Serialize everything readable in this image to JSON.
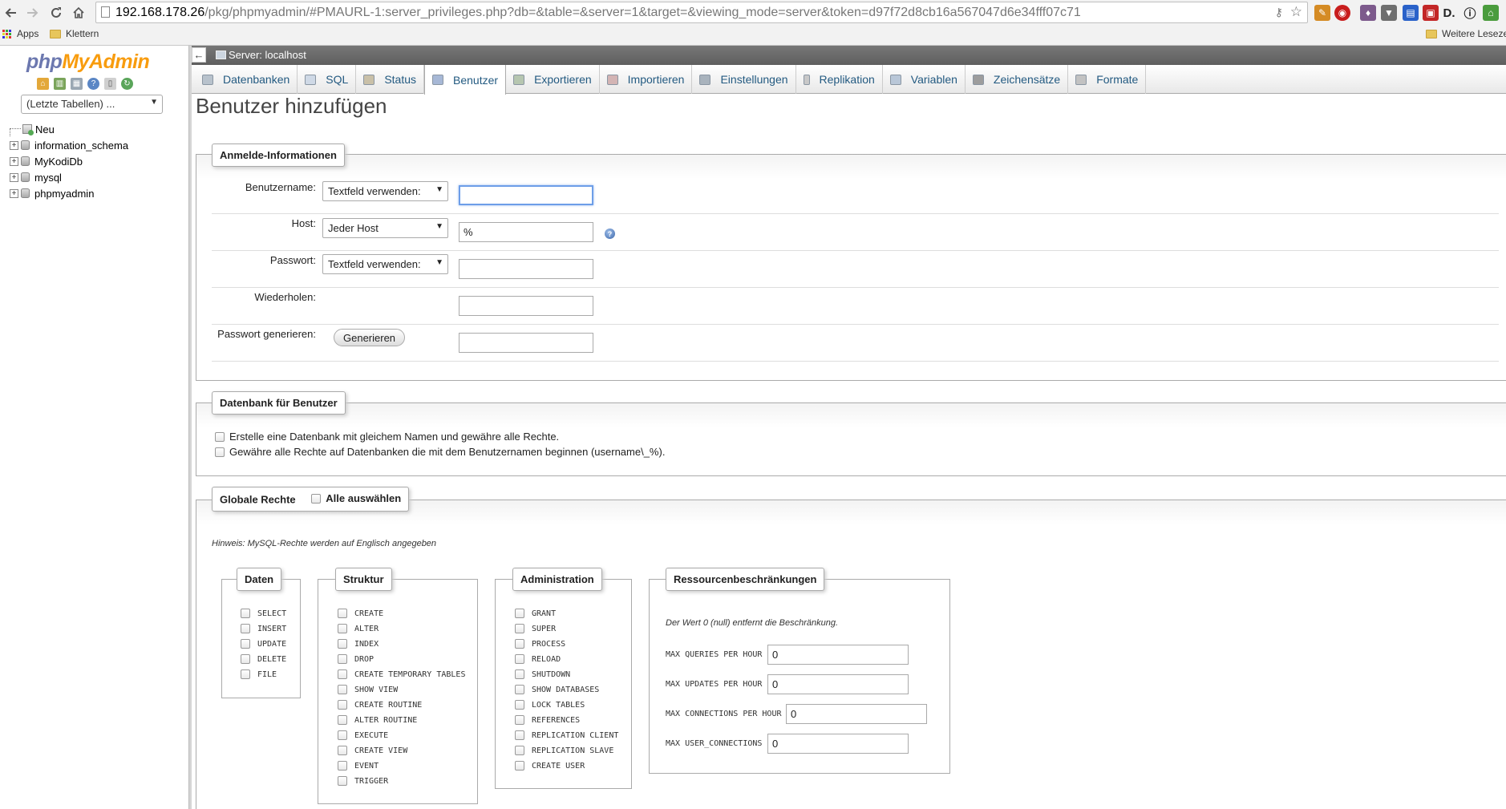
{
  "browser": {
    "url_host": "192.168.178.26",
    "url_path": "/pkg/phpmyadmin/#PMAURL-1:server_privileges.php?db=&table=&server=1&target=&viewing_mode=server&token=d97f72d8cb16a567047d6e34fff07c71",
    "bookmarks": {
      "apps": "Apps",
      "klettern": "Klettern",
      "weitere": "Weitere Leseze"
    }
  },
  "nav": {
    "logo_php": "php",
    "logo_myadmin": "MyAdmin",
    "recent_tables": "(Letzte Tabellen) ...",
    "tree": [
      {
        "label": "Neu"
      },
      {
        "label": "information_schema"
      },
      {
        "label": "MyKodiDb"
      },
      {
        "label": "mysql"
      },
      {
        "label": "phpmyadmin"
      }
    ]
  },
  "server_bar": {
    "label": "Server: localhost"
  },
  "tabs": [
    {
      "label": "Datenbanken"
    },
    {
      "label": "SQL"
    },
    {
      "label": "Status"
    },
    {
      "label": "Benutzer"
    },
    {
      "label": "Exportieren"
    },
    {
      "label": "Importieren"
    },
    {
      "label": "Einstellungen"
    },
    {
      "label": "Replikation"
    },
    {
      "label": "Variablen"
    },
    {
      "label": "Zeichensätze"
    },
    {
      "label": "Formate"
    }
  ],
  "page_title": "Benutzer hinzufügen",
  "login": {
    "legend": "Anmelde-Informationen",
    "username_label": "Benutzername:",
    "username_select": "Textfeld verwenden:",
    "username_value": "",
    "host_label": "Host:",
    "host_select": "Jeder Host",
    "host_value": "%",
    "password_label": "Passwort:",
    "password_select": "Textfeld verwenden:",
    "repeat_label": "Wiederholen:",
    "generate_label": "Passwort generieren:",
    "generate_button": "Generieren"
  },
  "database": {
    "legend": "Datenbank für Benutzer",
    "option1": "Erstelle eine Datenbank mit gleichem Namen und gewähre alle Rechte.",
    "option2": "Gewähre alle Rechte auf Datenbanken die mit dem Benutzernamen beginnen (username\\_%)."
  },
  "global": {
    "legend": "Globale Rechte",
    "select_all": "Alle auswählen",
    "hint": "Hinweis: MySQL-Rechte werden auf Englisch angegeben",
    "daten": {
      "legend": "Daten",
      "items": [
        "SELECT",
        "INSERT",
        "UPDATE",
        "DELETE",
        "FILE"
      ]
    },
    "struktur": {
      "legend": "Struktur",
      "items": [
        "CREATE",
        "ALTER",
        "INDEX",
        "DROP",
        "CREATE TEMPORARY TABLES",
        "SHOW VIEW",
        "CREATE ROUTINE",
        "ALTER ROUTINE",
        "EXECUTE",
        "CREATE VIEW",
        "EVENT",
        "TRIGGER"
      ]
    },
    "administration": {
      "legend": "Administration",
      "items": [
        "GRANT",
        "SUPER",
        "PROCESS",
        "RELOAD",
        "SHUTDOWN",
        "SHOW DATABASES",
        "LOCK TABLES",
        "REFERENCES",
        "REPLICATION CLIENT",
        "REPLICATION SLAVE",
        "CREATE USER"
      ]
    },
    "resources": {
      "legend": "Ressourcenbeschränkungen",
      "hint": "Der Wert 0 (null) entfernt die Beschränkung.",
      "rows": [
        {
          "label": "MAX QUERIES PER HOUR",
          "value": "0"
        },
        {
          "label": "MAX UPDATES PER HOUR",
          "value": "0"
        },
        {
          "label": "MAX CONNECTIONS PER HOUR",
          "value": "0"
        },
        {
          "label": "MAX USER_CONNECTIONS",
          "value": "0"
        }
      ]
    }
  }
}
